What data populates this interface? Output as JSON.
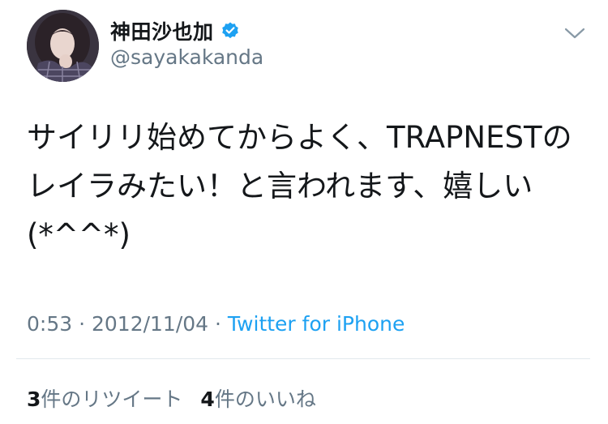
{
  "author": {
    "display_name": "神田沙也加",
    "handle": "@sayakakanda",
    "verified": true
  },
  "tweet": {
    "text_lines": [
      "サイリリ始めてからよく、TRAPNESTの",
      "レイラみたい！と言われます、嬉しい",
      "(*^^*)"
    ],
    "time": "0:53",
    "separator": " · ",
    "date": "2012/11/04",
    "source": "Twitter for iPhone"
  },
  "stats": {
    "retweets": {
      "count": "3",
      "label": "件のリツイート"
    },
    "likes": {
      "count": "4",
      "label": "件のいいね"
    }
  },
  "colors": {
    "accent": "#1da1f2",
    "secondary_text": "#657786",
    "primary_text": "#14171a",
    "divider": "#e1e8ed"
  },
  "icons": {
    "verified": "verified-badge-icon",
    "more": "chevron-down-icon"
  }
}
